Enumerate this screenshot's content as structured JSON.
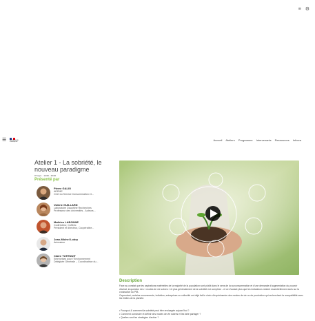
{
  "top_right": {
    "menu_icon": "list-icon",
    "filter_icon": "settings-icon"
  },
  "navbar": {
    "menu_icon": "hamburger-icon",
    "logo_text": "RÉPUBLIQUE FRANÇAISE",
    "links": [
      "Accueil",
      "Ateliers",
      "Programme",
      "Intervenants",
      "Ressources",
      "Infocra"
    ]
  },
  "workshop": {
    "title": "Atelier 1 - La sobriété, le nouveau paradigme",
    "date": "07 sept. · 14:00 - 15:00",
    "presented_by_label": "Présenté par"
  },
  "speakers": [
    {
      "name": "Pierre GALIO",
      "role": "ADEME",
      "role2": "Chef du Service Consommation et..."
    },
    {
      "name": "Valérie GUILLARD",
      "role": "Laboratoire Dauphine Recherches",
      "role2": "Professeur des universités - Auteurs..."
    },
    {
      "name": "Mathieu LABONNE",
      "role": "Codirecteur, Cofibric",
      "role2": "Président et directeur, Coopérative..."
    },
    {
      "name": "Jean-Michel Lobry",
      "role": "Animateur",
      "role2": ""
    },
    {
      "name": "Claire TUTENUIT",
      "role": "Entreprises pour l'Environnement",
      "role2": "Déléguée Générale – Coordinatrice du..."
    }
  ],
  "video": {
    "play_icon": "play-icon"
  },
  "description": {
    "title": "Description",
    "paragraphs": [
      "Face au constat que les aspirations matérielles de la majorité de la population sont plutôt dans le sens de la surconsommation et d'une demande d'augmentation du pouvoir d'achat, la question des « modes de vie sobres » et plus généralement de la sobriété est complexe - et ce d'autant plus que les indicateurs restent essentiellement axés sur la croissance du PIB.",
      "Cependant, certains mouvements, individus, entreprises ou collectifs ont déjà fait le choix d'expérimenter des modes de vie ou de production qui recherchent la compatibilité avec les limites de la planète."
    ],
    "bullets": [
      "• Pourquoi & comment la sobriété peut être envisagée aujourd'hui ?",
      "• Comment construire et définir des modes de vie sobres et les faire partager ?",
      "• Quelles sont les stratégies d'action ?"
    ]
  },
  "colors": {
    "accent": "#6aa83a",
    "presented": "#8bc34a"
  }
}
